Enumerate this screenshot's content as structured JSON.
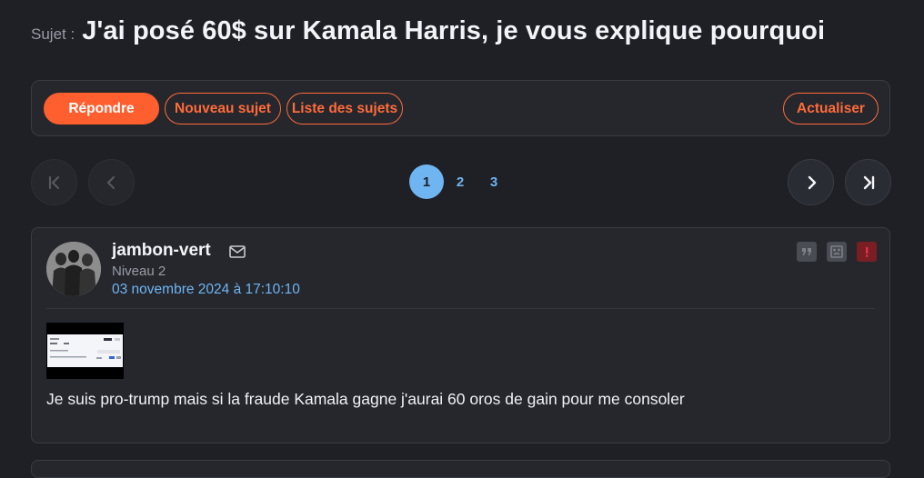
{
  "topic": {
    "prefix": "Sujet :",
    "title": "J'ai posé 60$ sur Kamala Harris, je vous explique pourquoi"
  },
  "actions": {
    "reply": "Répondre",
    "new_topic": "Nouveau sujet",
    "topic_list": "Liste des sujets",
    "refresh": "Actualiser"
  },
  "pagination": {
    "pages": [
      "1",
      "2",
      "3"
    ],
    "current": 1,
    "first_icon": "first-page-icon",
    "prev_icon": "chevron-left-icon",
    "next_icon": "chevron-right-icon",
    "last_icon": "last-page-icon"
  },
  "post": {
    "author": "jambon-vert",
    "level": "Niveau 2",
    "date": "03 novembre 2024 à 17:10:10",
    "body": "Je suis pro-trump mais si la fraude Kamala gagne j'aurai 60 oros de gain pour me consoler",
    "icons": [
      "quote-icon",
      "sad-face-icon",
      "report-icon",
      "mail-icon"
    ]
  },
  "colors": {
    "accent": "#ff5e2e",
    "link": "#6fb5f2",
    "background": "#1f2025",
    "card": "#25272d"
  }
}
